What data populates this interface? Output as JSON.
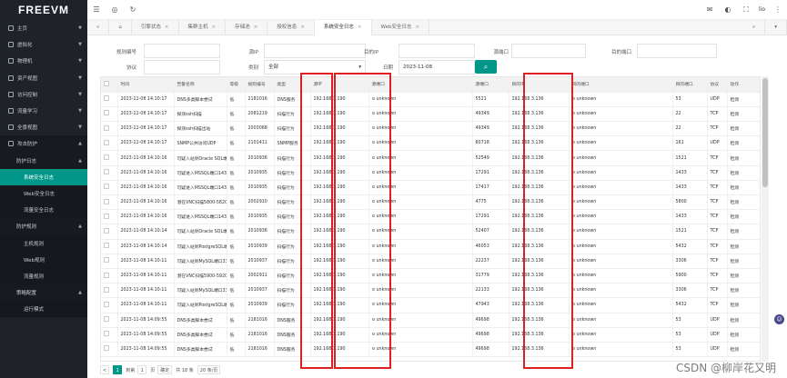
{
  "app": {
    "logo": "FREEVM"
  },
  "sidebar": {
    "items": [
      {
        "label": "主页",
        "icon": "home-icon"
      },
      {
        "label": "虚拟化",
        "icon": "cloud-icon"
      },
      {
        "label": "物理机",
        "icon": "server-icon"
      },
      {
        "label": "资产视图",
        "icon": "asset-icon"
      },
      {
        "label": "访问控制",
        "icon": "lock-icon"
      },
      {
        "label": "流量学习",
        "icon": "flow-icon"
      },
      {
        "label": "全景视图",
        "icon": "view-icon"
      },
      {
        "label": "攻击防护",
        "icon": "shield-icon"
      }
    ],
    "sub_header": "防护日志",
    "sub_items": [
      "系统安全日志",
      "Web安全日志",
      "流量安全日志"
    ],
    "sub_header2": "防护规则",
    "sub_items2": [
      "主机规则",
      "Web规则",
      "流量规则"
    ],
    "sub_header3": "策略配置",
    "sub_items3": [
      "运行模式"
    ]
  },
  "topbar": {
    "user": "lio"
  },
  "tabs": [
    "引擎状态",
    "集群主机",
    "存储池",
    "授权信息",
    "系统安全日志",
    "Web安全日志"
  ],
  "filters": {
    "rule_no": "规则编号",
    "src_ip": "源IP",
    "dst_ip": "目的IP",
    "src_port": "源端口",
    "dst_port": "目的端口",
    "protocol": "协议",
    "category": "类别",
    "category_value": "全部",
    "date": "日期",
    "date_value": "2023-11-08"
  },
  "table": {
    "headers": [
      "时间",
      "告警名称",
      "等级",
      "规则编号",
      "类型",
      "源IP",
      "源端口",
      "源端口",
      "目的IP",
      "目的端口",
      "目的端口",
      "协议",
      "动作"
    ],
    "rows": [
      [
        "2023-11-08 14:10:17",
        "DNS多类脚本尝试",
        "低",
        "2181016",
        "DNS服务",
        "192.168.3.190",
        "unknown",
        "5521",
        "192.168.3.136",
        "unknown",
        "53",
        "UDP",
        "检测"
      ],
      [
        "2023-11-08 14:10:17",
        "探测ssh扫描",
        "低",
        "2081219",
        "扫描行为",
        "192.168.3.190",
        "unknown",
        "49349",
        "192.168.3.136",
        "unknown",
        "22",
        "TCP",
        "检测"
      ],
      [
        "2023-11-08 14:10:17",
        "探测ssh扫描出站",
        "低",
        "2003068",
        "扫描行为",
        "192.168.3.190",
        "unknown",
        "49349",
        "192.168.3.136",
        "unknown",
        "22",
        "TCP",
        "检测"
      ],
      [
        "2023-11-08 14:10:17",
        "SNMP公共访问UDP",
        "低",
        "2101411",
        "SNMP服务",
        "192.168.3.190",
        "unknown",
        "60718",
        "192.168.3.136",
        "unknown",
        "161",
        "UDP",
        "检测"
      ],
      [
        "2023-11-08 14:10:16",
        "可疑入站到Oracle SQL端口1521",
        "低",
        "2010936",
        "扫描行为",
        "192.168.3.190",
        "unknown",
        "52549",
        "192.168.3.136",
        "unknown",
        "1521",
        "TCP",
        "检测"
      ],
      [
        "2023-11-08 14:10:16",
        "可疑进入MSSQL端口1433",
        "低",
        "2010935",
        "扫描行为",
        "192.168.3.190",
        "unknown",
        "17291",
        "192.168.3.136",
        "unknown",
        "1433",
        "TCP",
        "检测"
      ],
      [
        "2023-11-08 14:10:16",
        "可疑进入MSSQL端口1433",
        "低",
        "2010935",
        "扫描行为",
        "192.168.3.190",
        "unknown",
        "17417",
        "192.168.3.136",
        "unknown",
        "1433",
        "TCP",
        "检测"
      ],
      [
        "2023-11-08 14:10:16",
        "潜在VNC扫描5800-5820",
        "低",
        "2002910",
        "扫描行为",
        "192.168.3.190",
        "unknown",
        "4775",
        "192.168.3.136",
        "unknown",
        "5800",
        "TCP",
        "检测"
      ],
      [
        "2023-11-08 14:10:16",
        "可疑进入MSSQL端口1433",
        "低",
        "2010935",
        "扫描行为",
        "192.168.3.190",
        "unknown",
        "17291",
        "192.168.3.136",
        "unknown",
        "1433",
        "TCP",
        "检测"
      ],
      [
        "2023-11-08 14:10:14",
        "可疑入站到Oracle SQL端口1521",
        "低",
        "2010936",
        "扫描行为",
        "192.168.3.190",
        "unknown",
        "52407",
        "192.168.3.136",
        "unknown",
        "1521",
        "TCP",
        "检测"
      ],
      [
        "2023-11-08 14:10:14",
        "可疑入站到PostgreSQL端口5432",
        "低",
        "2010939",
        "扫描行为",
        "192.168.3.190",
        "unknown",
        "46053",
        "192.168.3.136",
        "unknown",
        "5432",
        "TCP",
        "检测"
      ],
      [
        "2023-11-08 14:10:11",
        "可疑入站到MySQL端口3306",
        "低",
        "2010937",
        "扫描行为",
        "192.168.3.190",
        "unknown",
        "22237",
        "192.168.3.136",
        "unknown",
        "3306",
        "TCP",
        "检测"
      ],
      [
        "2023-11-08 14:10:11",
        "潜在VNC扫描5900-5920",
        "低",
        "2002911",
        "扫描行为",
        "192.168.3.190",
        "unknown",
        "31779",
        "192.168.3.136",
        "unknown",
        "5900",
        "TCP",
        "检测"
      ],
      [
        "2023-11-08 14:10:11",
        "可疑入站到MySQL端口3306",
        "低",
        "2010937",
        "扫描行为",
        "192.168.3.190",
        "unknown",
        "22133",
        "192.168.3.136",
        "unknown",
        "3306",
        "TCP",
        "检测"
      ],
      [
        "2023-11-08 14:10:11",
        "可疑入站到PostgreSQL端口5432",
        "低",
        "2010939",
        "扫描行为",
        "192.168.3.190",
        "unknown",
        "47943",
        "192.168.3.136",
        "unknown",
        "5432",
        "TCP",
        "检测"
      ],
      [
        "2023-11-08 14:09:55",
        "DNS多类脚本尝试",
        "低",
        "2181016",
        "DNS服务",
        "192.168.3.190",
        "unknown",
        "49698",
        "192.168.3.136",
        "unknown",
        "53",
        "UDP",
        "检测"
      ],
      [
        "2023-11-08 14:09:55",
        "DNS多类脚本尝试",
        "低",
        "2181016",
        "DNS服务",
        "192.168.3.190",
        "unknown",
        "49698",
        "192.168.3.136",
        "unknown",
        "53",
        "UDP",
        "检测"
      ],
      [
        "2023-11-08 14:09:55",
        "DNS多类脚本尝试",
        "低",
        "2181016",
        "DNS服务",
        "192.168.3.190",
        "unknown",
        "49698",
        "192.168.3.136",
        "unknown",
        "53",
        "UDP",
        "检测"
      ]
    ]
  },
  "pager": {
    "prev": "<",
    "page": "1",
    "goto_label": "到第",
    "page_input": "1",
    "page_unit": "页",
    "confirm": "确定",
    "total": "共 18 条",
    "per_page": "20 条/页"
  },
  "watermark": "CSDN @柳岸花又明",
  "colors": {
    "accent": "#009688",
    "highlight": "#e02020",
    "sidebar": "#20222a"
  }
}
